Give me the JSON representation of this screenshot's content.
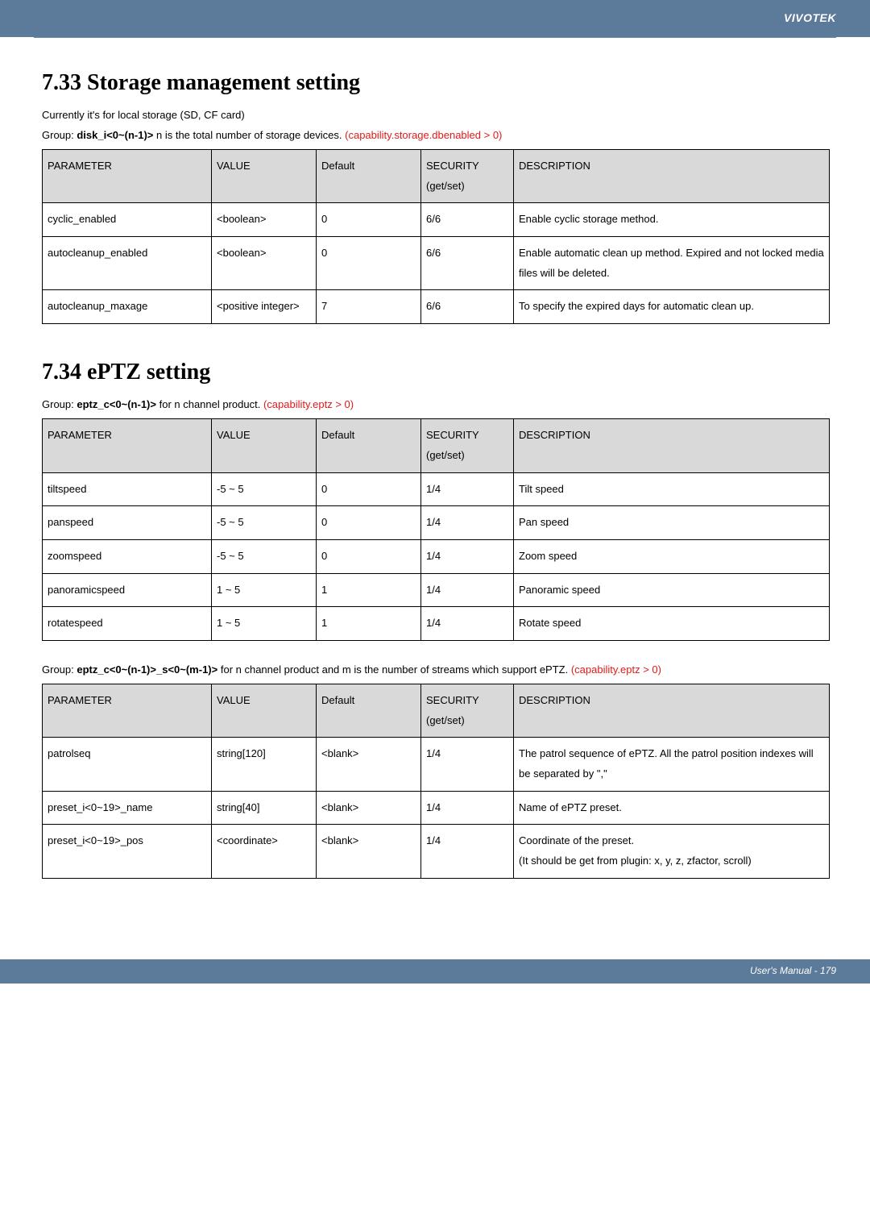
{
  "brand": "VIVOTEK",
  "section_733_heading": "7.33 Storage management setting",
  "section_733_intro": "Currently it's for local storage (SD, CF card)",
  "section_733_group_prefix": "Group: ",
  "section_733_group_bold": "disk_i<0~(n-1)>",
  "section_733_group_rest": " n is the total number of storage devices. ",
  "section_733_group_red": "(capability.storage.dbenabled > 0)",
  "headers": {
    "param": "PARAMETER",
    "value": "VALUE",
    "default": "Default",
    "security": "SECURITY",
    "security2": "(get/set)",
    "desc": "DESCRIPTION"
  },
  "table733": [
    {
      "param": "cyclic_enabled",
      "value": "<boolean>",
      "default": "0",
      "security": "6/6",
      "desc": "Enable cyclic storage method."
    },
    {
      "param": "autocleanup_enabled",
      "value": "<boolean>",
      "default": "0",
      "security": "6/6",
      "desc": "Enable automatic clean up method. Expired and not locked media files will be deleted."
    },
    {
      "param": "autocleanup_maxage",
      "value": "<positive integer>",
      "default": "7",
      "security": "6/6",
      "desc": "To specify the expired days for automatic clean up."
    }
  ],
  "section_734_heading": "7.34 ePTZ setting",
  "section_734_group_prefix": "Group: ",
  "section_734_group_bold": "eptz_c<0~(n-1)>",
  "section_734_group_rest": " for n channel product. ",
  "section_734_group_red": "(capability.eptz > 0)",
  "table734a": [
    {
      "param": "tiltspeed",
      "value": "-5 ~ 5",
      "default": "0",
      "security": "1/4",
      "desc": "Tilt speed"
    },
    {
      "param": "panspeed",
      "value": "-5 ~ 5",
      "default": "0",
      "security": "1/4",
      "desc": "Pan speed"
    },
    {
      "param": "zoomspeed",
      "value": "-5 ~ 5",
      "default": "0",
      "security": "1/4",
      "desc": "Zoom speed"
    },
    {
      "param": "panoramicspeed",
      "value": "1 ~ 5",
      "default": "1",
      "security": "1/4",
      "desc": "Panoramic speed"
    },
    {
      "param": "rotatespeed",
      "value": "1 ~ 5",
      "default": "1",
      "security": "1/4",
      "desc": "Rotate speed"
    }
  ],
  "section_734b_group_prefix": "Group: ",
  "section_734b_group_bold": "eptz_c<0~(n-1)>_s<0~(m-1)>",
  "section_734b_group_rest": " for n channel product and m is the number of streams which support ePTZ. ",
  "section_734b_group_red": "(capability.eptz > 0)",
  "table734b": [
    {
      "param": "patrolseq",
      "value": "string[120]",
      "default": "<blank>",
      "security": "1/4",
      "desc": "The patrol sequence of ePTZ. All the patrol position indexes will be separated by \",\""
    },
    {
      "param": "preset_i<0~19>_name",
      "value": "string[40]",
      "default": "<blank>",
      "security": "1/4",
      "desc": "Name of ePTZ preset."
    },
    {
      "param": "preset_i<0~19>_pos",
      "value": "<coordinate>",
      "default": "<blank>",
      "security": "1/4",
      "desc": "Coordinate of the preset.\n(It should be get from plugin: x, y, z, zfactor, scroll)"
    }
  ],
  "footer_text": "User's Manual - 179"
}
